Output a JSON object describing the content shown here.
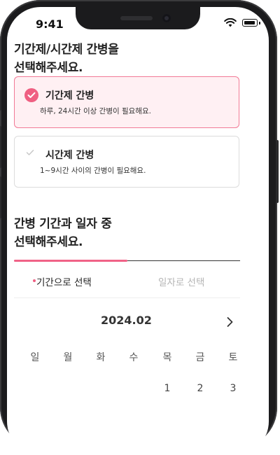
{
  "status_bar": {
    "time": "9:41"
  },
  "headings": {
    "type_question_line1": "기간제/시간제 간병을",
    "type_question_line2": "선택해주세요.",
    "period_question_line1": "간병 기간과 일자 중",
    "period_question_line2": "선택해주세요."
  },
  "options": [
    {
      "title": "기간제 간병",
      "description": "하루, 24시간 이상 간병이 필요해요.",
      "selected": true
    },
    {
      "title": "시간제 간병",
      "description": "1~9시간 사이의 간병이 필요해요.",
      "selected": false
    }
  ],
  "progress": {
    "value": 0.5
  },
  "tabs": [
    {
      "label": "기간으로 선택",
      "active": true
    },
    {
      "label": "일자로 선택",
      "active": false
    }
  ],
  "calendar": {
    "month": "2024.02",
    "weekdays": [
      "일",
      "월",
      "화",
      "수",
      "목",
      "금",
      "토"
    ],
    "first_row_days": [
      "1",
      "2",
      "3"
    ]
  },
  "colors": {
    "accent": "#ef5f82",
    "selected_bg": "#fff0f3",
    "frame": "#1b1b1d"
  },
  "icons": [
    "wifi-icon",
    "battery-icon",
    "check-circle-icon",
    "check-icon",
    "chevron-right-icon"
  ]
}
